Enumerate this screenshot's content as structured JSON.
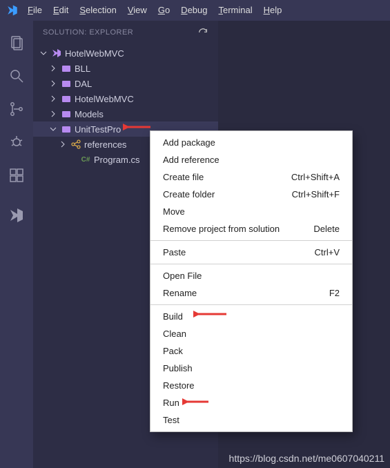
{
  "menubar": {
    "file": "File",
    "edit": "Edit",
    "selection": "Selection",
    "view": "View",
    "go": "Go",
    "debug": "Debug",
    "terminal": "Terminal",
    "help": "Help"
  },
  "explorer": {
    "title": "SOLUTION: EXPLORER",
    "root": "HotelWebMVC",
    "items": {
      "bll": "BLL",
      "dal": "DAL",
      "hotelwebmvc": "HotelWebMVC",
      "models": "Models",
      "unittestpro": "UnitTestPro",
      "references": "references",
      "programcs": "Program.cs"
    }
  },
  "contextMenu": {
    "addPackage": "Add package",
    "addReference": "Add reference",
    "createFile": "Create file",
    "createFileKey": "Ctrl+Shift+A",
    "createFolder": "Create folder",
    "createFolderKey": "Ctrl+Shift+F",
    "move": "Move",
    "removeProject": "Remove project from solution",
    "removeProjectKey": "Delete",
    "paste": "Paste",
    "pasteKey": "Ctrl+V",
    "openFile": "Open File",
    "rename": "Rename",
    "renameKey": "F2",
    "build": "Build",
    "clean": "Clean",
    "pack": "Pack",
    "publish": "Publish",
    "restore": "Restore",
    "run": "Run",
    "test": "Test"
  },
  "watermark": "https://blog.csdn.net/me0607040211"
}
